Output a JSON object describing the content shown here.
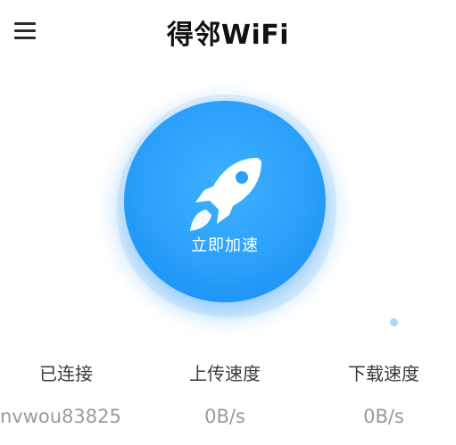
{
  "header": {
    "title": "得邻WiFi",
    "menu_icon": "hamburger-menu-icon"
  },
  "boost": {
    "label": "立即加速",
    "icon": "rocket-icon",
    "accent_color": "#2aa0fb"
  },
  "stats": {
    "connected": {
      "label": "已连接",
      "value": "nvwou83825"
    },
    "upload_speed": {
      "label": "上传速度",
      "value": "0B/s"
    },
    "download_speed": {
      "label": "下载速度",
      "value": "0B/s"
    }
  }
}
